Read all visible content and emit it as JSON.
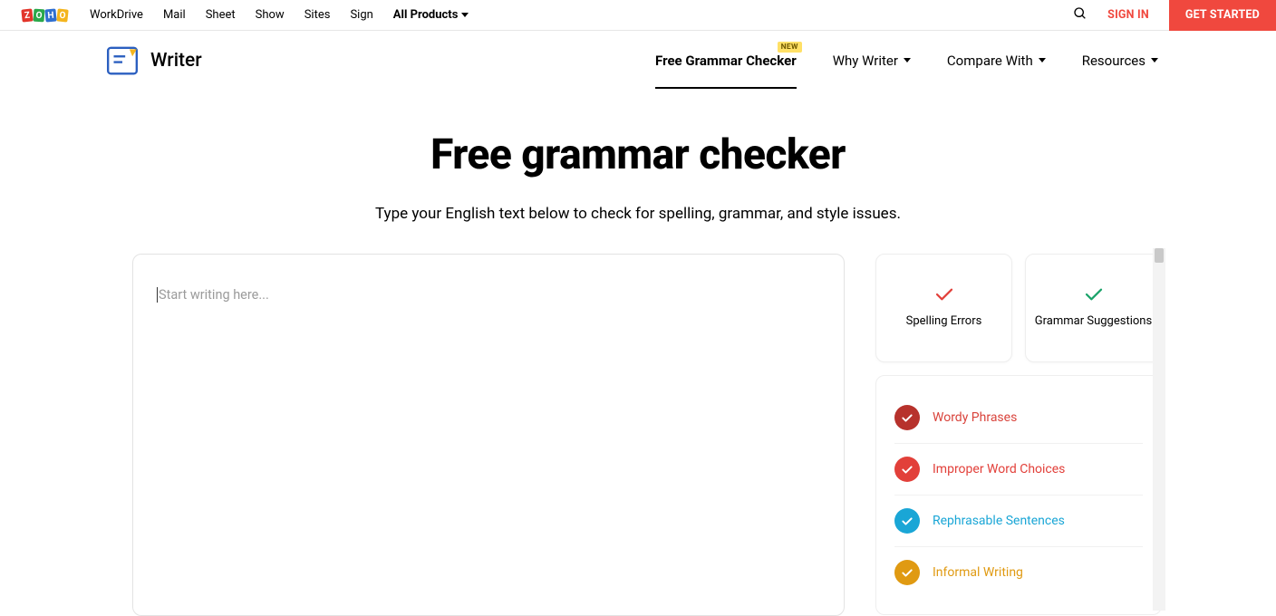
{
  "topnav": {
    "items": [
      "WorkDrive",
      "Mail",
      "Sheet",
      "Show",
      "Sites",
      "Sign"
    ],
    "all_products": "All Products",
    "sign_in": "SIGN IN",
    "get_started": "GET STARTED"
  },
  "product": {
    "name": "Writer"
  },
  "secondnav": {
    "items": [
      {
        "label": "Free Grammar Checker",
        "badge": "NEW",
        "active": true,
        "dropdown": false
      },
      {
        "label": "Why Writer",
        "active": false,
        "dropdown": true
      },
      {
        "label": "Compare With",
        "active": false,
        "dropdown": true
      },
      {
        "label": "Resources",
        "active": false,
        "dropdown": true
      }
    ]
  },
  "hero": {
    "title": "Free grammar checker",
    "subtitle": "Type your English text below to check for spelling, grammar, and style issues."
  },
  "editor": {
    "placeholder": "Start writing here..."
  },
  "cards": {
    "spelling": "Spelling Errors",
    "grammar": "Grammar Suggestions"
  },
  "checks": [
    {
      "label": "Wordy Phrases",
      "color": "#b7322c",
      "text_color": "#d9433b"
    },
    {
      "label": "Improper Word Choices",
      "color": "#e2403a",
      "text_color": "#e2403a"
    },
    {
      "label": "Rephrasable Sentences",
      "color": "#1aa6d6",
      "text_color": "#1aa6d6"
    },
    {
      "label": "Informal Writing",
      "color": "#e09a12",
      "text_color": "#e09a12"
    }
  ]
}
